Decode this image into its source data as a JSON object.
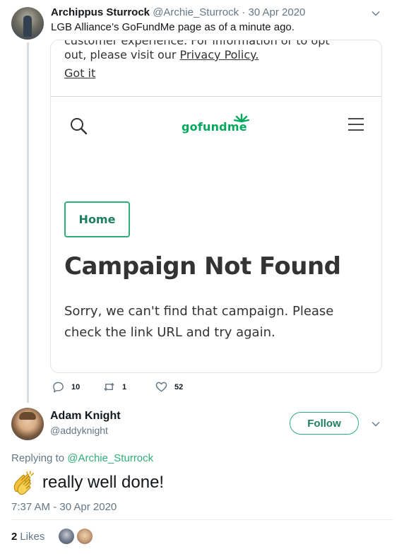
{
  "tweet": {
    "author_name": "Archippus Sturrock",
    "author_handle": "@Archie_Sturrock",
    "date": "30 Apr 2020",
    "text": "LGB Alliance’s GoFundMe page as of a minute ago.",
    "screenshot": {
      "cookie_cut_text": "customer experience. For information or to opt",
      "cookie_text_prefix": "out, please visit our ",
      "privacy_link": "Privacy Policy.",
      "got_it": "Got it",
      "logo_text": "gofundme",
      "home_button": "Home",
      "title": "Campaign Not Found",
      "body": "Sorry, we can't find that campaign. Please check the link URL and try again."
    },
    "stats": {
      "replies": "10",
      "retweets": "1",
      "likes": "52"
    },
    "icons": [
      "avatar",
      "chevron-down-icon",
      "search-icon",
      "gofundme-spark-icon",
      "menu-icon",
      "reply-icon",
      "retweet-icon",
      "heart-icon"
    ]
  },
  "reply": {
    "author_name": "Adam Knight",
    "author_handle": "@addyknight",
    "follow_label": "Follow",
    "replying_prefix": "Replying to",
    "replying_to": "@Archie_Sturrock",
    "text": "really well done!",
    "emoji": "clapping-hands-icon",
    "timestamp": "7:37 AM - 30 Apr 2020",
    "likes_count": "2",
    "likes_label": "Likes"
  },
  "colors": {
    "gofundme_green": "#02a95c",
    "accent_green": "#2fae7a",
    "muted": "#657786",
    "text": "#14171a"
  }
}
